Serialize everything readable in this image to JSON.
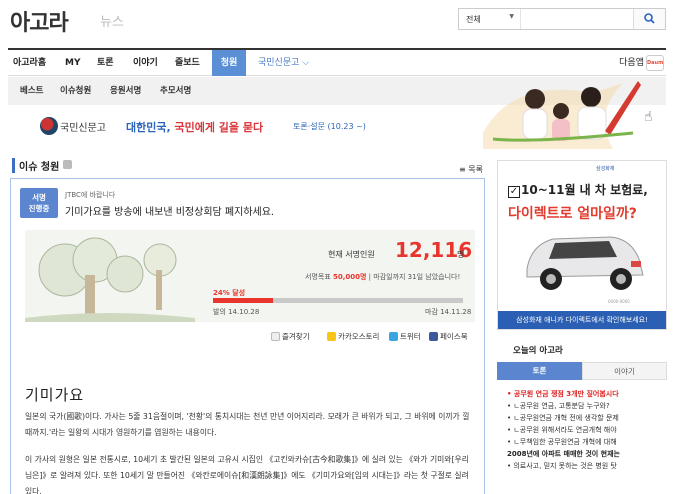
{
  "header": {
    "logo": "아고라",
    "logo_sub": "뉴스",
    "search_select": "전체",
    "search_placeholder": ""
  },
  "nav": {
    "items": [
      "아고라홈",
      "MY",
      "토론",
      "이야기",
      "즐보드",
      "청원",
      "국민신문고 ⌵"
    ],
    "active": "청원",
    "right": "다음앱",
    "right_logo": "Daum"
  },
  "subnav": {
    "items": [
      "베스트",
      "이슈청원",
      "응원서명",
      "추모서명"
    ]
  },
  "banner": {
    "org": "국민신문고",
    "slogan_main": "대한민국, ",
    "slogan_em": "국민에게 길을 묻다",
    "date": "토론·설문 (10.23 ~)"
  },
  "section": {
    "title": "이슈 청원",
    "list_link": "≡ 목록"
  },
  "petition": {
    "badge_line1": "서명",
    "badge_line2": "진행중",
    "to": "JTBC에 바랍니다",
    "title": "기미가요를 방송에 내보낸 비정상회담 폐지하세요.",
    "current_label": "현재 서명인원",
    "current_count": "12,116",
    "current_unit": "명",
    "goal_label": "서명목표 ",
    "goal_value": "50,000명",
    "goal_rest": " | 마감일까지 31일 남았습니다!",
    "progress_label": "24% 달성",
    "progress": 0.24,
    "start": "발의  14.10.28",
    "end": "마감  14.11.28",
    "heading": "기미가요",
    "paragraph1": "일본의 국가(國歌)이다. 가사는 5줄 31음절이며, '천황'의 통치시대는 천년 만년 이어지리라. 모래가 큰 바위가 되고, 그 바위에 이끼가 낄 때까지.'라는 일왕의 시대가 영원하기를 염원하는 내용이다.",
    "paragraph2": "이 가사의 원형은 일본 전통시로, 10세기 초 발간된 일본의 고유시 시집인 《고킨와카슈[古今和歌集]》에 실려 있는 《와가 기미와[우리 님은]》로 알려져 있다. 또한 10세기 말 만들어진 《와칸로에이슈[和漢朗詠集]》에도 《기미가요와[임의 시대는]》라는 첫 구절로 실려 있다."
  },
  "share": {
    "bookmark": "즐겨찾기",
    "kakao": "카카오스토리",
    "twitter": "트위터",
    "facebook": "페이스북"
  },
  "ad": {
    "brand": "삼성화재",
    "line1": "10~11월 내 차 보험료,",
    "line2": "다이렉트로 얼마일까?",
    "small": "0000-0000",
    "bottom": "삼성화재 애니카 다이렉트에서 확인해보세요!"
  },
  "today": {
    "title": "오늘의 아고라",
    "tab_on": "토론",
    "tab_off": "이야기",
    "issues": [
      "• 공무원 연금 쟁점 3개만 짚어봅시다",
      "• ㄴ공무원 연금, 고통분담 누구와?",
      "• ㄴ공무원연금 개혁 전에 생각할 문제",
      "• ㄴ공무원 위해서라도 연금개혁 해야",
      "• ㄴ무책임한 공무원연금 개혁에 대해",
      "2008년에 아파트 매매한 것이 현재는",
      "• 의료사고, 믿지 못하는 것은 병원 탓"
    ]
  },
  "colors": {
    "accent": "#5a8fd6",
    "count_red": "#e8362c",
    "slogan_blue": "#2a65b9"
  }
}
